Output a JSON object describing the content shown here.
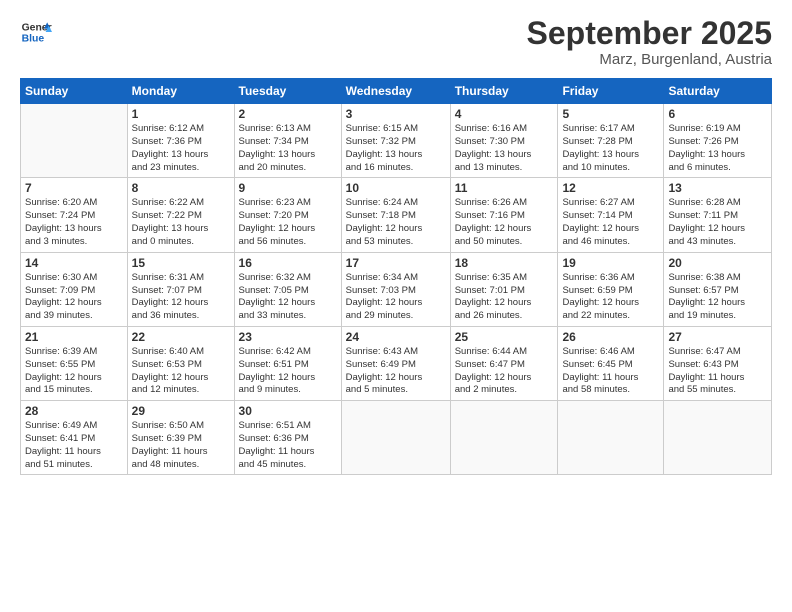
{
  "logo": {
    "general": "General",
    "blue": "Blue"
  },
  "header": {
    "month": "September 2025",
    "location": "Marz, Burgenland, Austria"
  },
  "weekdays": [
    "Sunday",
    "Monday",
    "Tuesday",
    "Wednesday",
    "Thursday",
    "Friday",
    "Saturday"
  ],
  "weeks": [
    [
      {
        "day": "",
        "info": ""
      },
      {
        "day": "1",
        "info": "Sunrise: 6:12 AM\nSunset: 7:36 PM\nDaylight: 13 hours\nand 23 minutes."
      },
      {
        "day": "2",
        "info": "Sunrise: 6:13 AM\nSunset: 7:34 PM\nDaylight: 13 hours\nand 20 minutes."
      },
      {
        "day": "3",
        "info": "Sunrise: 6:15 AM\nSunset: 7:32 PM\nDaylight: 13 hours\nand 16 minutes."
      },
      {
        "day": "4",
        "info": "Sunrise: 6:16 AM\nSunset: 7:30 PM\nDaylight: 13 hours\nand 13 minutes."
      },
      {
        "day": "5",
        "info": "Sunrise: 6:17 AM\nSunset: 7:28 PM\nDaylight: 13 hours\nand 10 minutes."
      },
      {
        "day": "6",
        "info": "Sunrise: 6:19 AM\nSunset: 7:26 PM\nDaylight: 13 hours\nand 6 minutes."
      }
    ],
    [
      {
        "day": "7",
        "info": "Sunrise: 6:20 AM\nSunset: 7:24 PM\nDaylight: 13 hours\nand 3 minutes."
      },
      {
        "day": "8",
        "info": "Sunrise: 6:22 AM\nSunset: 7:22 PM\nDaylight: 13 hours\nand 0 minutes."
      },
      {
        "day": "9",
        "info": "Sunrise: 6:23 AM\nSunset: 7:20 PM\nDaylight: 12 hours\nand 56 minutes."
      },
      {
        "day": "10",
        "info": "Sunrise: 6:24 AM\nSunset: 7:18 PM\nDaylight: 12 hours\nand 53 minutes."
      },
      {
        "day": "11",
        "info": "Sunrise: 6:26 AM\nSunset: 7:16 PM\nDaylight: 12 hours\nand 50 minutes."
      },
      {
        "day": "12",
        "info": "Sunrise: 6:27 AM\nSunset: 7:14 PM\nDaylight: 12 hours\nand 46 minutes."
      },
      {
        "day": "13",
        "info": "Sunrise: 6:28 AM\nSunset: 7:11 PM\nDaylight: 12 hours\nand 43 minutes."
      }
    ],
    [
      {
        "day": "14",
        "info": "Sunrise: 6:30 AM\nSunset: 7:09 PM\nDaylight: 12 hours\nand 39 minutes."
      },
      {
        "day": "15",
        "info": "Sunrise: 6:31 AM\nSunset: 7:07 PM\nDaylight: 12 hours\nand 36 minutes."
      },
      {
        "day": "16",
        "info": "Sunrise: 6:32 AM\nSunset: 7:05 PM\nDaylight: 12 hours\nand 33 minutes."
      },
      {
        "day": "17",
        "info": "Sunrise: 6:34 AM\nSunset: 7:03 PM\nDaylight: 12 hours\nand 29 minutes."
      },
      {
        "day": "18",
        "info": "Sunrise: 6:35 AM\nSunset: 7:01 PM\nDaylight: 12 hours\nand 26 minutes."
      },
      {
        "day": "19",
        "info": "Sunrise: 6:36 AM\nSunset: 6:59 PM\nDaylight: 12 hours\nand 22 minutes."
      },
      {
        "day": "20",
        "info": "Sunrise: 6:38 AM\nSunset: 6:57 PM\nDaylight: 12 hours\nand 19 minutes."
      }
    ],
    [
      {
        "day": "21",
        "info": "Sunrise: 6:39 AM\nSunset: 6:55 PM\nDaylight: 12 hours\nand 15 minutes."
      },
      {
        "day": "22",
        "info": "Sunrise: 6:40 AM\nSunset: 6:53 PM\nDaylight: 12 hours\nand 12 minutes."
      },
      {
        "day": "23",
        "info": "Sunrise: 6:42 AM\nSunset: 6:51 PM\nDaylight: 12 hours\nand 9 minutes."
      },
      {
        "day": "24",
        "info": "Sunrise: 6:43 AM\nSunset: 6:49 PM\nDaylight: 12 hours\nand 5 minutes."
      },
      {
        "day": "25",
        "info": "Sunrise: 6:44 AM\nSunset: 6:47 PM\nDaylight: 12 hours\nand 2 minutes."
      },
      {
        "day": "26",
        "info": "Sunrise: 6:46 AM\nSunset: 6:45 PM\nDaylight: 11 hours\nand 58 minutes."
      },
      {
        "day": "27",
        "info": "Sunrise: 6:47 AM\nSunset: 6:43 PM\nDaylight: 11 hours\nand 55 minutes."
      }
    ],
    [
      {
        "day": "28",
        "info": "Sunrise: 6:49 AM\nSunset: 6:41 PM\nDaylight: 11 hours\nand 51 minutes."
      },
      {
        "day": "29",
        "info": "Sunrise: 6:50 AM\nSunset: 6:39 PM\nDaylight: 11 hours\nand 48 minutes."
      },
      {
        "day": "30",
        "info": "Sunrise: 6:51 AM\nSunset: 6:36 PM\nDaylight: 11 hours\nand 45 minutes."
      },
      {
        "day": "",
        "info": ""
      },
      {
        "day": "",
        "info": ""
      },
      {
        "day": "",
        "info": ""
      },
      {
        "day": "",
        "info": ""
      }
    ]
  ]
}
